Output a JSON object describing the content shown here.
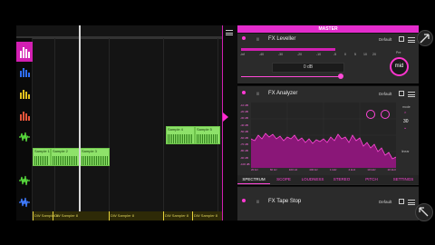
{
  "left_toolbar": {
    "button_a": "◯",
    "button_b": "+",
    "button_c": "+"
  },
  "clips": [
    {
      "label": "Sample 1"
    },
    {
      "label": "Sample 2"
    },
    {
      "label": "Sample 3"
    },
    {
      "label": "Sample 4"
    },
    {
      "label": "Sample 5"
    }
  ],
  "bottom_clips": [
    {
      "label": "DW Sampler 8"
    },
    {
      "label": "DW Sampler 8"
    },
    {
      "label": "DW Sampler 8"
    },
    {
      "label": "DW Sampler 8"
    },
    {
      "label": "DW Sampler 8"
    }
  ],
  "master": {
    "header": "MASTER"
  },
  "leveller": {
    "title": "FX Leveller",
    "preset": "Default",
    "scale": [
      "-inf",
      "-40",
      "-30",
      "-20",
      "-10",
      "-5",
      "0",
      "5",
      "10",
      "20"
    ],
    "db_readout": "0 dB",
    "knob_label": "mid",
    "knob_top_label": "Pre"
  },
  "analyzer": {
    "title": "FX Analyzer",
    "preset": "Default",
    "y_labels": [
      "-10 dB",
      "-20 dB",
      "-30 dB",
      "-40 dB",
      "-50 dB",
      "-60 dB",
      "-70 dB",
      "-80 dB",
      "-90 dB",
      "-100 dB"
    ],
    "x_labels": [
      "20 Hz",
      "60 Hz",
      "100 Hz",
      "400 Hz",
      "1 kHz",
      "4 kHz",
      "10 kHz",
      "20 kHz"
    ],
    "side_top": "mode",
    "side_value": "30",
    "side_bottom": "linear"
  },
  "tabs": [
    "SPECTRUM",
    "SCOPE",
    "LOUDNESS",
    "STEREO",
    "PITCH",
    "SETTINGS"
  ],
  "tape_stop": {
    "title": "FX Tape Stop",
    "preset": "Default"
  },
  "colors": {
    "accent": "#e32ccc",
    "clip_green": "#8ee26a",
    "background": "#141414"
  }
}
